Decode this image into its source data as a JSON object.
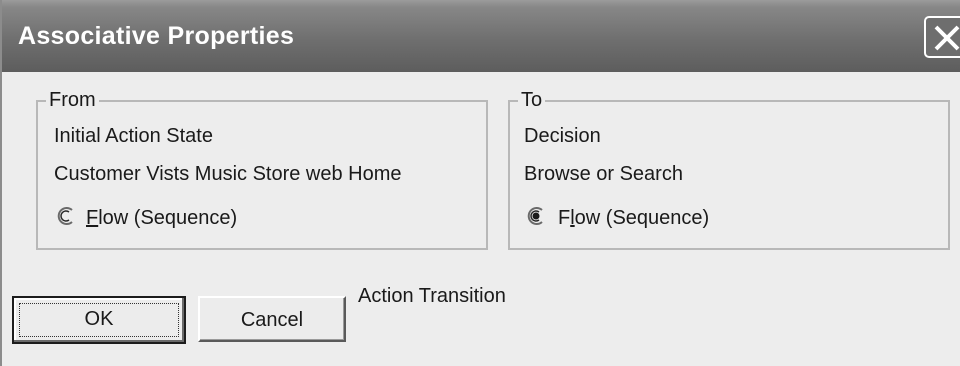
{
  "window": {
    "title": "Associative Properties"
  },
  "from": {
    "label": "From",
    "type": "Initial Action State",
    "name": "Customer Vists Music Store web Home",
    "radio_label": "Flow (Sequence)",
    "radio_mnemonic": "F",
    "radio_rest": "low (Sequence)",
    "selected": false
  },
  "to": {
    "label": "To",
    "type": "Decision",
    "name": "Browse or Search",
    "radio_label": "Flow (Sequence)",
    "radio_prefix": "F",
    "radio_mnemonic": "l",
    "radio_rest": "ow (Sequence)",
    "selected": true
  },
  "buttons": {
    "ok_label": "OK",
    "cancel_label": "Cancel"
  },
  "association_label": "Action Transition",
  "colors": {
    "titlebar": "#6f6f6f",
    "dialog_background": "#ededed",
    "group_border": "#b8b8b8"
  }
}
